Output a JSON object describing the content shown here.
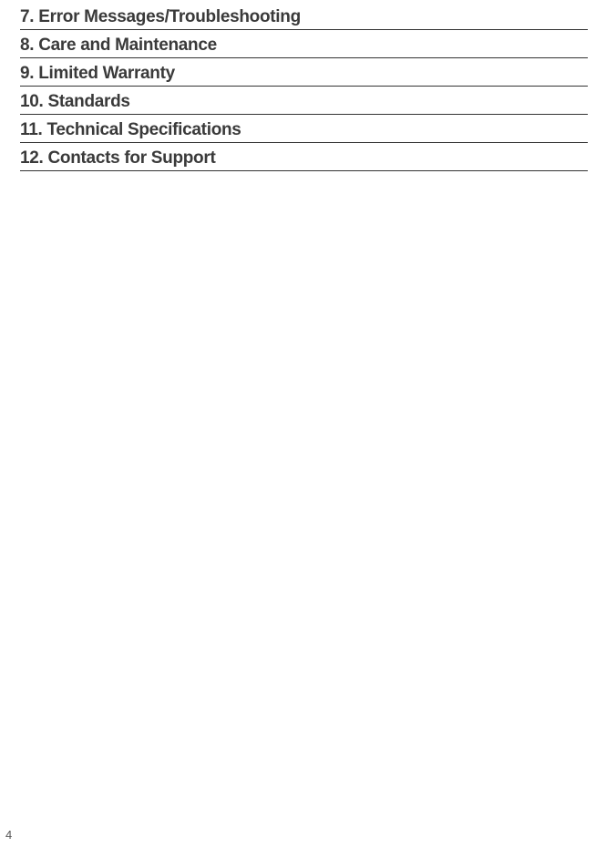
{
  "toc": {
    "entries": [
      {
        "label": "7. Error Messages/Troubleshooting"
      },
      {
        "label": "8. Care and Maintenance"
      },
      {
        "label": "9.  Limited Warranty"
      },
      {
        "label": "10.  Standards"
      },
      {
        "label": "11. Technical Specifications"
      },
      {
        "label": "12. Contacts for Support"
      }
    ]
  },
  "page_number": "4"
}
